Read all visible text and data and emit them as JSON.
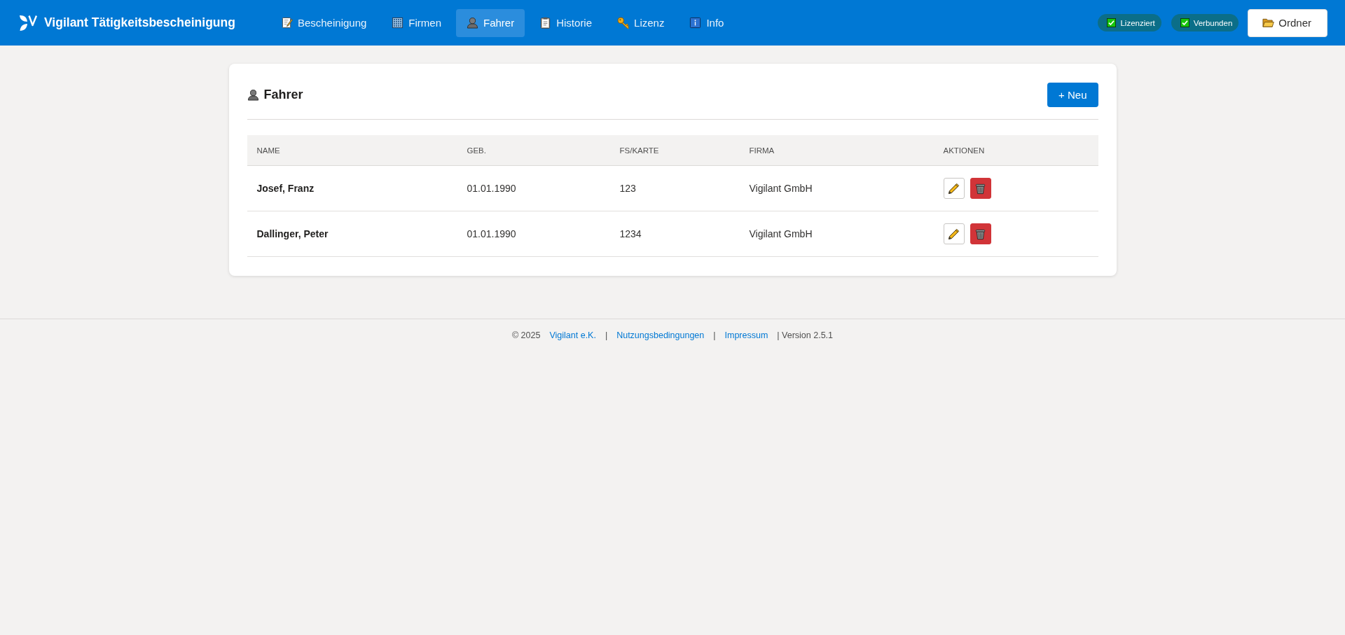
{
  "app": {
    "title": "Vigilant Tätigkeitsbescheinigung"
  },
  "nav": [
    {
      "label": "Bescheinigung",
      "selected": false
    },
    {
      "label": "Firmen",
      "selected": false
    },
    {
      "label": "Fahrer",
      "selected": true
    },
    {
      "label": "Historie",
      "selected": false
    },
    {
      "label": "Lizenz",
      "selected": false
    },
    {
      "label": "Info",
      "selected": false
    }
  ],
  "status": [
    {
      "label": "Lizenziert",
      "checked": true
    },
    {
      "label": "Verbunden",
      "checked": true
    }
  ],
  "folder_button": {
    "label": "Ordner"
  },
  "card": {
    "title": "Fahrer",
    "new_button": "+ Neu"
  },
  "table": {
    "columns": [
      "NAME",
      "GEB.",
      "FS/KARTE",
      "FIRMA",
      "AKTIONEN"
    ],
    "rows": [
      {
        "name": "Josef, Franz",
        "geb": "01.01.1990",
        "fs_karte": "123",
        "firma": "Vigilant GmbH"
      },
      {
        "name": "Dallinger, Peter",
        "geb": "01.01.1990",
        "fs_karte": "1234",
        "firma": "Vigilant GmbH"
      }
    ]
  },
  "footer": [
    {
      "kind": "text",
      "text": "© 2025"
    },
    {
      "kind": "link",
      "text": "Vigilant e.K."
    },
    {
      "kind": "separator",
      "text": "|"
    },
    {
      "kind": "link",
      "text": "Nutzungsbedingungen"
    },
    {
      "kind": "separator",
      "text": "|"
    },
    {
      "kind": "link",
      "text": "Impressum"
    },
    {
      "kind": "text",
      "text": "| Version 2.5.1"
    }
  ]
}
